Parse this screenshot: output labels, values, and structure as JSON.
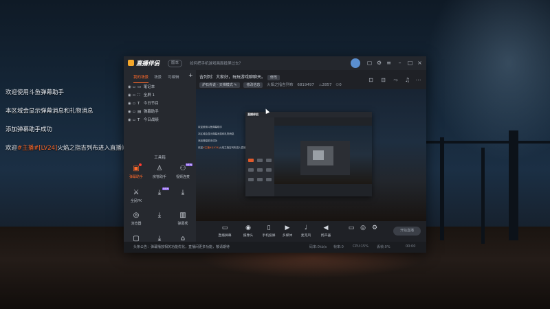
{
  "desktop": {
    "chat_lines": [
      {
        "text": "欢迎使用斗鱼弹幕助手"
      },
      {
        "text": "本区域会显示弹幕消息和礼物消息"
      },
      {
        "text": "添加弹幕助手成功"
      },
      {
        "prefix": "欢迎",
        "highlight": "#主播#[LV24]",
        "name": "火焰之指吉列布",
        "suffix": "进入直播间"
      }
    ]
  },
  "app": {
    "brand": "直播伴侣",
    "version": "版本",
    "notice": "如何把手机游戏画面投屏过去？",
    "window_controls": [
      "minimize-icon",
      "maximize-icon",
      "close-icon"
    ],
    "sidebar": {
      "tabs": [
        "我的场景",
        "场景",
        "可编辑"
      ],
      "add_label": "+",
      "scenes": [
        "笔记本",
        "全屏 1",
        "今日节目",
        "弹幕助手",
        "今日战绩"
      ],
      "tools_header": "工具箱",
      "tools": [
        {
          "label": "弹幕助手",
          "icon": "chat-icon",
          "active": true,
          "badge": "dot"
        },
        {
          "label": "房管助手",
          "icon": "user-icon",
          "active": false
        },
        {
          "label": "视频连麦",
          "icon": "video-icon",
          "active": false,
          "badge": "NEW"
        },
        {
          "label": "全民PK",
          "icon": "pk-icon",
          "active": false
        },
        {
          "label": "",
          "icon": "download-icon",
          "active": false,
          "badge": "NEW"
        },
        {
          "label": "",
          "icon": "download-icon",
          "active": false
        },
        {
          "label": "浏览器",
          "icon": "browser-icon",
          "active": false
        },
        {
          "label": "",
          "icon": "download-icon",
          "active": false
        },
        {
          "label": "弹幕秀",
          "icon": "screen-icon",
          "active": false
        },
        {
          "label": "",
          "icon": "stop-icon",
          "active": false
        },
        {
          "label": "",
          "icon": "download-icon",
          "active": false
        },
        {
          "label": "",
          "icon": "building-icon",
          "active": false
        }
      ]
    },
    "room": {
      "title": "吉列列：大家好，玩玩游戏聊聊天。",
      "edit_label": "修改",
      "category": "炉石传说 · 天梯模式",
      "info_button": "修改信息",
      "room_name": "火焰之指吉列布",
      "room_id": "6819497",
      "heat": "2857",
      "viewers": "0"
    },
    "preview_chat": [
      {
        "text": "欢迎使用斗鱼弹幕助手"
      },
      {
        "text": "本区域会显示弹幕消息和礼物消息"
      },
      {
        "text": "添加弹幕助手成功"
      },
      {
        "prefix": "欢迎",
        "highlight": "#主播#[LV24]",
        "name": "火焰之指吉列布",
        "suffix": "进入直播间"
      }
    ],
    "controls": [
      {
        "label": "直播屏幕",
        "icon": "monitor-icon"
      },
      {
        "label": "摄像头",
        "icon": "camera-icon"
      },
      {
        "label": "手机投屏",
        "icon": "phone-cast-icon"
      },
      {
        "label": "多媒体",
        "icon": "media-icon"
      },
      {
        "label": "麦克风",
        "icon": "mic-icon"
      },
      {
        "label": "扬声器",
        "icon": "speaker-icon"
      }
    ],
    "start_label": "开始直播",
    "footer": {
      "message": "头条公告：弹幕播放相关功能优化，直播间更多功能，敬请期待",
      "stats": [
        "码率:0kb/s",
        "帧率:0",
        "CPU:15%",
        "丢帧:0%",
        "00:00"
      ]
    }
  }
}
